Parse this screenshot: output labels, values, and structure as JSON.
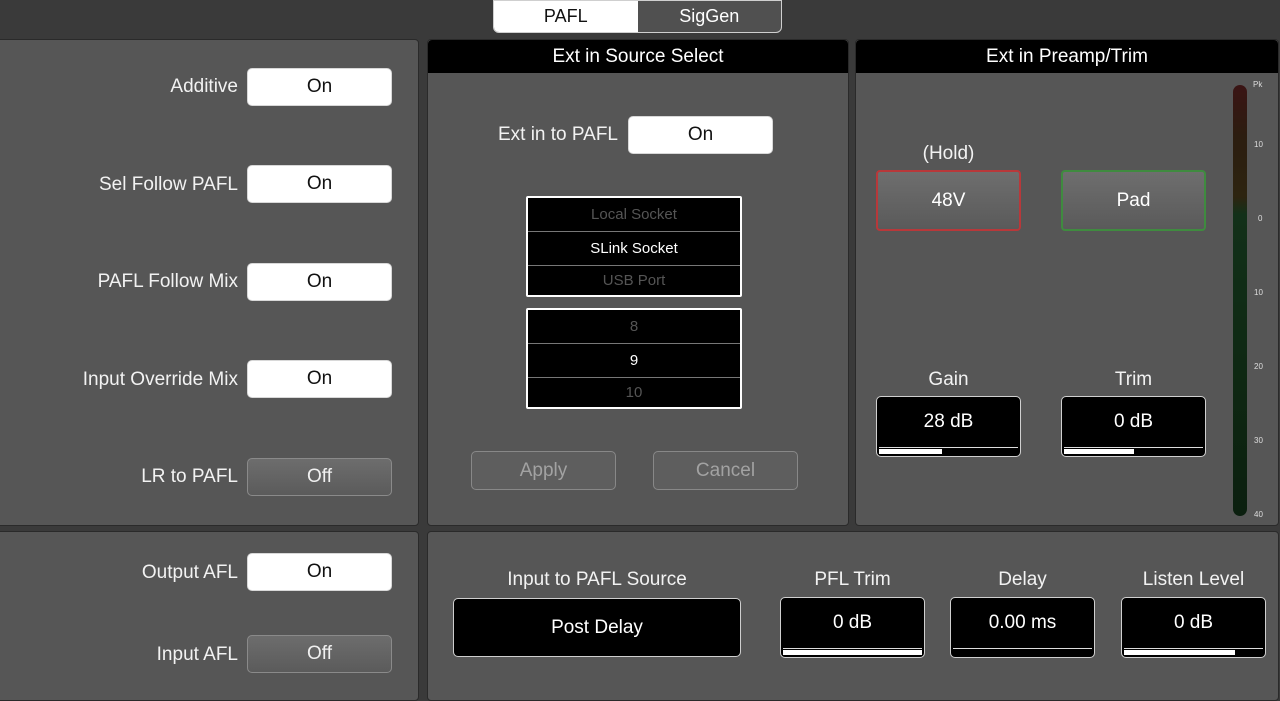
{
  "tabs": [
    {
      "label": "PAFL",
      "active": true
    },
    {
      "label": "SigGen",
      "active": false
    }
  ],
  "left_panel": {
    "rows": [
      {
        "label": "Additive",
        "value": "On",
        "state": "on"
      },
      {
        "label": "Sel Follow PAFL",
        "value": "On",
        "state": "on"
      },
      {
        "label": "PAFL Follow Mix",
        "value": "On",
        "state": "on"
      },
      {
        "label": "Input Override Mix",
        "value": "On",
        "state": "on"
      },
      {
        "label": "LR to PAFL",
        "value": "Off",
        "state": "off"
      }
    ]
  },
  "bottom_left_panel": {
    "rows": [
      {
        "label": "Output AFL",
        "value": "On",
        "state": "on"
      },
      {
        "label": "Input AFL",
        "value": "Off",
        "state": "off"
      }
    ]
  },
  "source_select": {
    "title": "Ext in Source Select",
    "ext_in_label": "Ext in to PAFL",
    "ext_in_value": "On",
    "socket_options": [
      "Local Socket",
      "SLink Socket",
      "USB Port"
    ],
    "socket_selected": "SLink Socket",
    "channel_options": [
      "8",
      "9",
      "10"
    ],
    "channel_selected": "9",
    "apply_label": "Apply",
    "cancel_label": "Cancel"
  },
  "preamp": {
    "title": "Ext in Preamp/Trim",
    "hold_label": "(Hold)",
    "phantom_label": "48V",
    "pad_label": "Pad",
    "gain_label": "Gain",
    "gain_value": "28 dB",
    "gain_level": 0.45,
    "trim_label": "Trim",
    "trim_value": "0 dB",
    "trim_level": 0.5,
    "meter_ticks": [
      "Pk",
      "10",
      "0",
      "10",
      "20",
      "30",
      "40"
    ],
    "colors": {
      "phantom_border": "#b8383a",
      "pad_border": "#3f8b3f"
    }
  },
  "bottom_panel": {
    "source_label": "Input to PAFL Source",
    "source_value": "Post Delay",
    "pfl_trim_label": "PFL Trim",
    "pfl_trim_value": "0 dB",
    "pfl_trim_level": 1.0,
    "delay_label": "Delay",
    "delay_value": "0.00 ms",
    "delay_level": 0.0,
    "listen_label": "Listen Level",
    "listen_value": "0 dB",
    "listen_level": 0.8
  }
}
